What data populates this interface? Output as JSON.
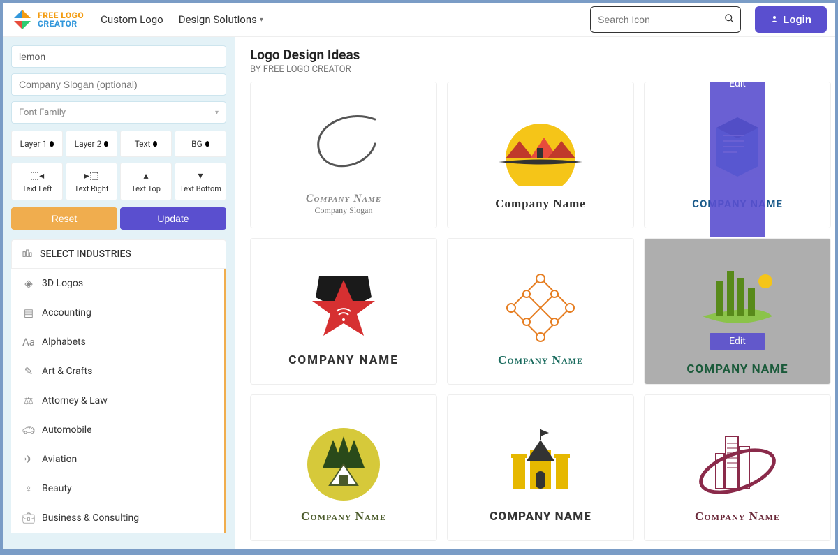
{
  "header": {
    "brand_line1": "FREE LOGO",
    "brand_line2": "CREATOR",
    "nav": {
      "custom": "Custom Logo",
      "solutions": "Design Solutions"
    },
    "search_placeholder": "Search Icon",
    "login": "Login"
  },
  "sidebar": {
    "company_name": "lemon",
    "slogan_placeholder": "Company Slogan (optional)",
    "font_placeholder": "Font Family",
    "layer1": "Layer 1",
    "layer2": "Layer 2",
    "text": "Text",
    "bg": "BG",
    "text_left": "Text Left",
    "text_right": "Text Right",
    "text_top": "Text Top",
    "text_bottom": "Text Bottom",
    "reset": "Reset",
    "update": "Update",
    "select_industries": "SELECT INDUSTRIES",
    "industries": [
      "3D Logos",
      "Accounting",
      "Alphabets",
      "Art & Crafts",
      "Attorney & Law",
      "Automobile",
      "Aviation",
      "Beauty",
      "Business & Consulting"
    ]
  },
  "content": {
    "title": "Logo Design Ideas",
    "subtitle": "BY FREE LOGO CREATOR",
    "card_label": "Company Name",
    "card_slogan": "Company Slogan",
    "card_label_upper": "COMPANY NAME",
    "edit": "Edit"
  }
}
